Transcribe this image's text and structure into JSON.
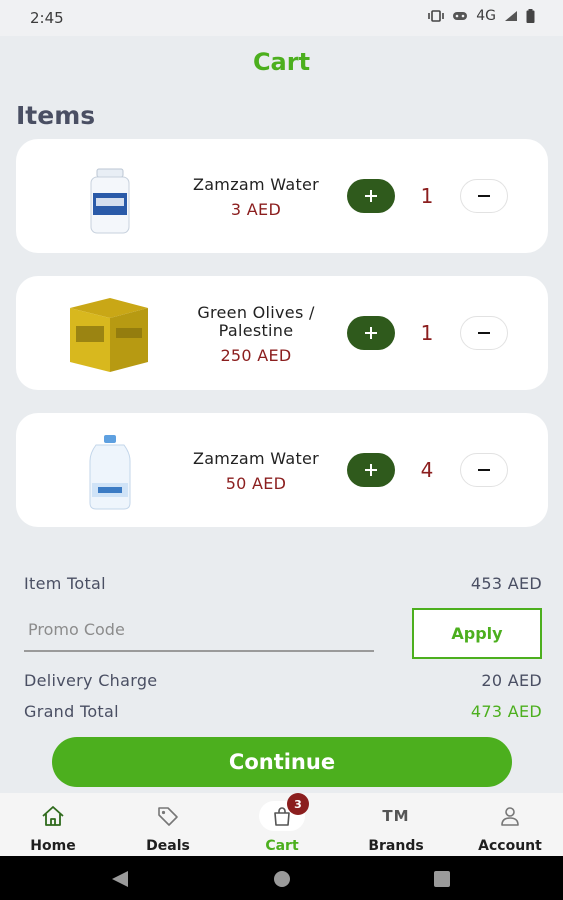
{
  "status_bar": {
    "time": "2:45",
    "network": "4G"
  },
  "header": {
    "title": "Cart"
  },
  "items_heading": "Items",
  "items": [
    {
      "name": "Zamzam Water",
      "price": "3 AED",
      "qty": "1",
      "image": "small-water-bottle"
    },
    {
      "name": "Green Olives / Palestine",
      "price": "250 AED",
      "qty": "1",
      "image": "olive-tin"
    },
    {
      "name": "Zamzam Water",
      "price": "50 AED",
      "qty": "4",
      "image": "large-water-jug"
    }
  ],
  "summary": {
    "item_total_label": "Item Total",
    "item_total_value": "453 AED",
    "promo_placeholder": "Promo Code",
    "apply_label": "Apply",
    "delivery_label": "Delivery Charge",
    "delivery_value": "20 AED",
    "grand_label": "Grand Total",
    "grand_value": "473 AED"
  },
  "continue_label": "Continue",
  "nav": {
    "home": "Home",
    "deals": "Deals",
    "cart": "Cart",
    "cart_badge": "3",
    "brands": "Brands",
    "brands_icon_text": "TM",
    "account": "Account"
  },
  "colors": {
    "accent": "#4caf1e",
    "price": "#8b1e1e",
    "plus_button": "#2f5a1c"
  }
}
